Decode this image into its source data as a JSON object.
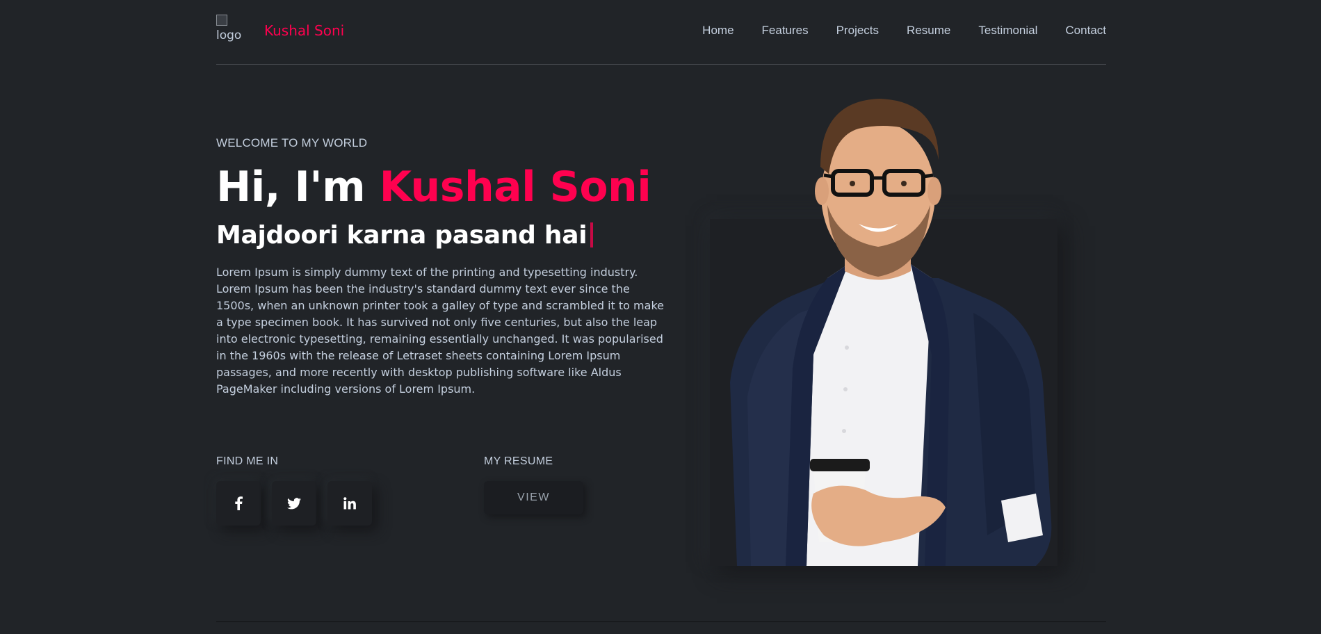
{
  "header": {
    "logo_alt": "logo",
    "brand": "Kushal Soni",
    "nav": [
      "Home",
      "Features",
      "Projects",
      "Resume",
      "Testimonial",
      "Contact"
    ]
  },
  "hero": {
    "welcome": "WELCOME TO MY WORLD",
    "greeting": "Hi, I'm ",
    "name": "Kushal Soni",
    "tagline": "Majdoori karna pasand hai",
    "description": "Lorem Ipsum is simply dummy text of the printing and typesetting industry. Lorem Ipsum has been the industry's standard dummy text ever since the 1500s, when an unknown printer took a galley of type and scrambled it to make a type specimen book. It has survived not only five centuries, but also the leap into electronic typesetting, remaining essentially unchanged. It was popularised in the 1960s with the release of Letraset sheets containing Lorem Ipsum passages, and more recently with desktop publishing software like Aldus PageMaker including versions of Lorem Ipsum."
  },
  "social": {
    "label": "FIND ME IN",
    "icons": [
      "facebook-icon",
      "twitter-icon",
      "linkedin-icon"
    ]
  },
  "resume": {
    "label": "MY RESUME",
    "button": "VIEW"
  },
  "colors": {
    "background": "#212428",
    "accent": "#ff014f",
    "text": "#c4cfde",
    "heading": "#ffffff"
  }
}
